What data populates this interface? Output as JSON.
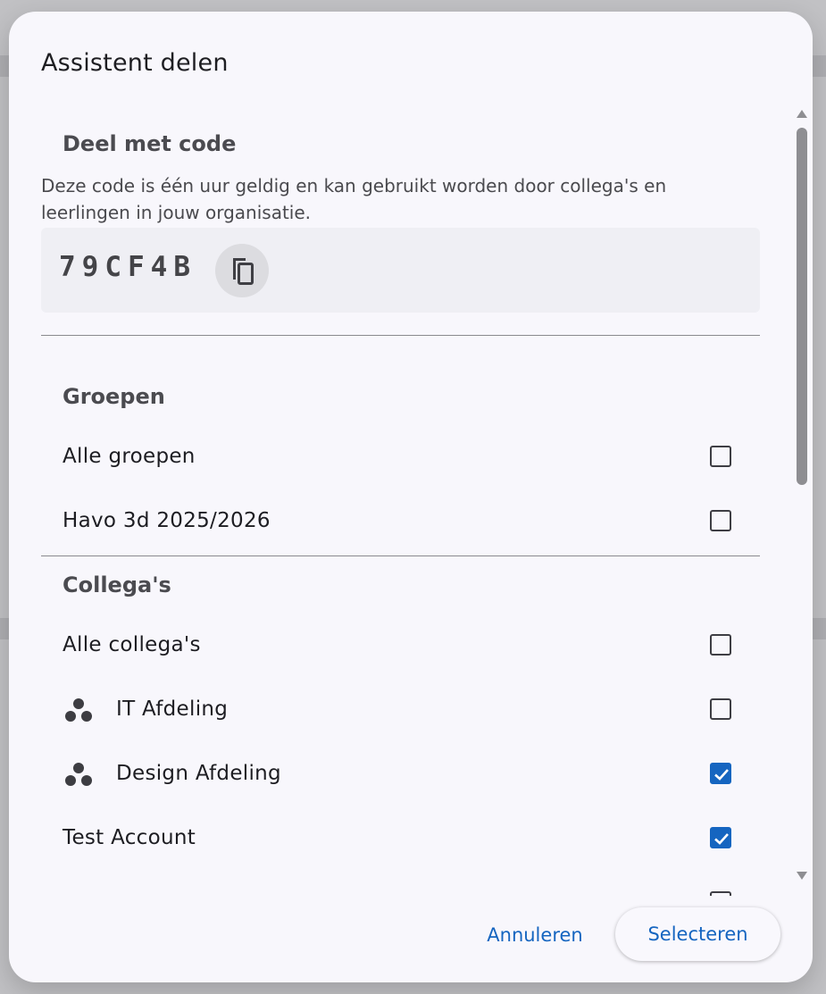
{
  "dialog": {
    "title": "Assistent delen",
    "share_code": {
      "heading": "Deel met code",
      "description": "Deze code is één uur geldig en kan gebruikt worden door collega's en leerlingen in jouw organisatie.",
      "code": "79CF4B",
      "copy_icon": "copy-icon"
    },
    "groups": {
      "heading": "Groepen",
      "items": [
        {
          "label": "Alle groepen",
          "checked": false
        },
        {
          "label": "Havo 3d 2025/2026",
          "checked": false
        }
      ]
    },
    "colleagues": {
      "heading": "Collega's",
      "items": [
        {
          "label": "Alle collega's",
          "checked": false,
          "icon": ""
        },
        {
          "label": "IT Afdeling",
          "checked": false,
          "icon": "team-icon"
        },
        {
          "label": "Design Afdeling",
          "checked": true,
          "icon": "team-icon"
        },
        {
          "label": "Test Account",
          "checked": true,
          "icon": ""
        }
      ]
    },
    "actions": {
      "cancel_label": "Annuleren",
      "select_label": "Selecteren"
    }
  },
  "colors": {
    "accent": "#1565c0",
    "dialog_bg": "#f8f7fc"
  }
}
